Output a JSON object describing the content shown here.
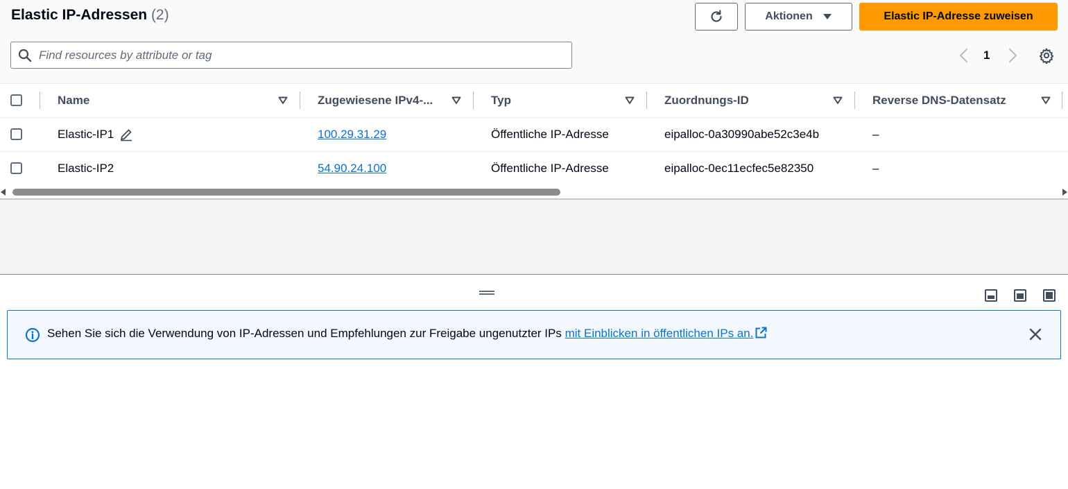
{
  "header": {
    "title": "Elastic IP-Adressen",
    "count": "(2)",
    "actions_label": "Aktionen",
    "primary_label": "Elastic IP-Adresse zuweisen"
  },
  "search": {
    "placeholder": "Find resources by attribute or tag"
  },
  "pagination": {
    "current_page": "1"
  },
  "table": {
    "columns": [
      "Name",
      "Zugewiesene IPv4-...",
      "Typ",
      "Zuordnungs-ID",
      "Reverse DNS-Datensatz"
    ],
    "rows": [
      {
        "name": "Elastic-IP1",
        "ip": "100.29.31.29",
        "type": "Öffentliche IP-Adresse",
        "allocation_id": "eipalloc-0a30990abe52c3e4b",
        "reverse_dns": "–"
      },
      {
        "name": "Elastic-IP2",
        "ip": "54.90.24.100",
        "type": "Öffentliche IP-Adresse",
        "allocation_id": "eipalloc-0ec11ecfec5e82350",
        "reverse_dns": "–"
      }
    ]
  },
  "flash": {
    "message": "Sehen Sie sich die Verwendung von IP-Adressen und Empfehlungen zur Freigabe ungenutzter IPs ",
    "link_text": "mit Einblicken in öffentlichen IPs an."
  },
  "icons": {
    "refresh": "refresh-icon",
    "caret": "caret-down-icon",
    "search": "search-icon",
    "settings": "gear-icon",
    "edit": "pencil-icon",
    "info": "info-icon",
    "external": "external-link-icon",
    "close": "close-icon"
  },
  "colors": {
    "primary": "#ff9900",
    "link": "#0972d3",
    "flash_bg": "#f2f8fd"
  }
}
